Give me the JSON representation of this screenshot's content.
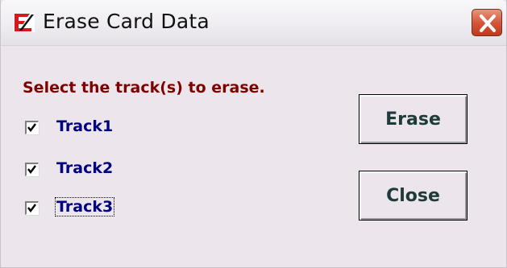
{
  "window": {
    "title": "Erase Card Data",
    "icon": "app-logo-icon",
    "close_icon": "close-icon"
  },
  "prompt": "Select the track(s) to erase.",
  "tracks": [
    {
      "label": "Track1",
      "checked": true
    },
    {
      "label": "Track2",
      "checked": true
    },
    {
      "label": "Track3",
      "checked": true,
      "focused": true
    }
  ],
  "buttons": {
    "erase_label": "Erase",
    "close_label": "Close"
  },
  "colors": {
    "prompt": "#800000",
    "track_label": "#000080",
    "background": "#ece6ec",
    "close_button": "#c0391e"
  }
}
